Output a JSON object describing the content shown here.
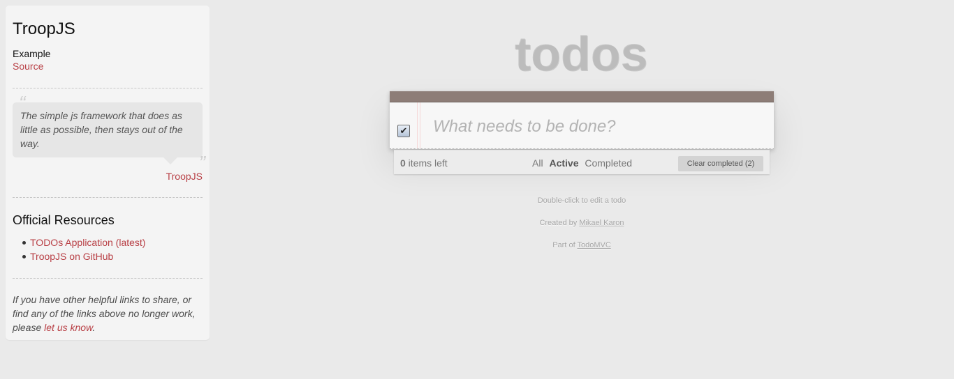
{
  "sidebar": {
    "title": "TroopJS",
    "example_label": "Example",
    "source_link": "Source",
    "quote_text": "The simple js framework that does as little as possible, then stays out of the way.",
    "quote_author": "TroopJS",
    "resources_heading": "Official Resources",
    "resources": [
      {
        "label": "TODOs Application (latest)"
      },
      {
        "label": "TroopJS on GitHub"
      }
    ],
    "footer_text_prefix": "If you have other helpful links to share, or find any of the links above no longer work, please ",
    "footer_link": "let us know",
    "footer_text_suffix": "."
  },
  "app": {
    "title": "todos",
    "new_todo_placeholder": "What needs to be done?",
    "toggle_all_checked": true,
    "footer": {
      "count": "0",
      "count_suffix": " items left",
      "filters": [
        {
          "label": "All",
          "selected": false
        },
        {
          "label": "Active",
          "selected": true
        },
        {
          "label": "Completed",
          "selected": false
        }
      ],
      "clear_completed": "Clear completed (2)"
    }
  },
  "info": {
    "hint": "Double-click to edit a todo",
    "created_prefix": "Created by ",
    "created_author": "Mikael Karon",
    "part_prefix": "Part of ",
    "part_link": "TodoMVC"
  },
  "colors": {
    "accent_link": "#b83f45",
    "topbar": "#8d7d77"
  }
}
